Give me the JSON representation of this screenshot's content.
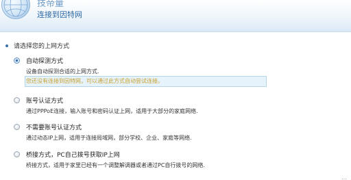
{
  "header": {
    "title": "技帝量",
    "subtitle": "连接到因特网",
    "icon": "globe-icon"
  },
  "prompt": "请选择您的上网方式",
  "options": [
    {
      "title": "自动探测方式",
      "description": "设备自动探测合适的上网方式.",
      "warning": "您还没有连接到因特网，可以通过此方式自动尝试连接。",
      "selected": true
    },
    {
      "title": "账号认证方式",
      "description": "通过PPPoE连接，输入账号和密码认证上网，适用于大部分的家庭网络.",
      "selected": false
    },
    {
      "title": "不需要账号认证方式",
      "description": "通过动态IP上网，适用于连接局域网，部分学校、企业、家庭等网络.",
      "selected": false
    },
    {
      "title": "桥接方式，PC自己拨号获取IP上网",
      "description": "桥接方式，适用于家里已经有一个调整解调器或者通过PC自行拨号的网络.",
      "selected": false
    }
  ],
  "footer_partial": "…",
  "colors": {
    "header_link": "#2f6aa6",
    "warning_text": "#c8a032",
    "warning_bg": "#e6f3fa",
    "radio_checked": "#2f6db0"
  }
}
